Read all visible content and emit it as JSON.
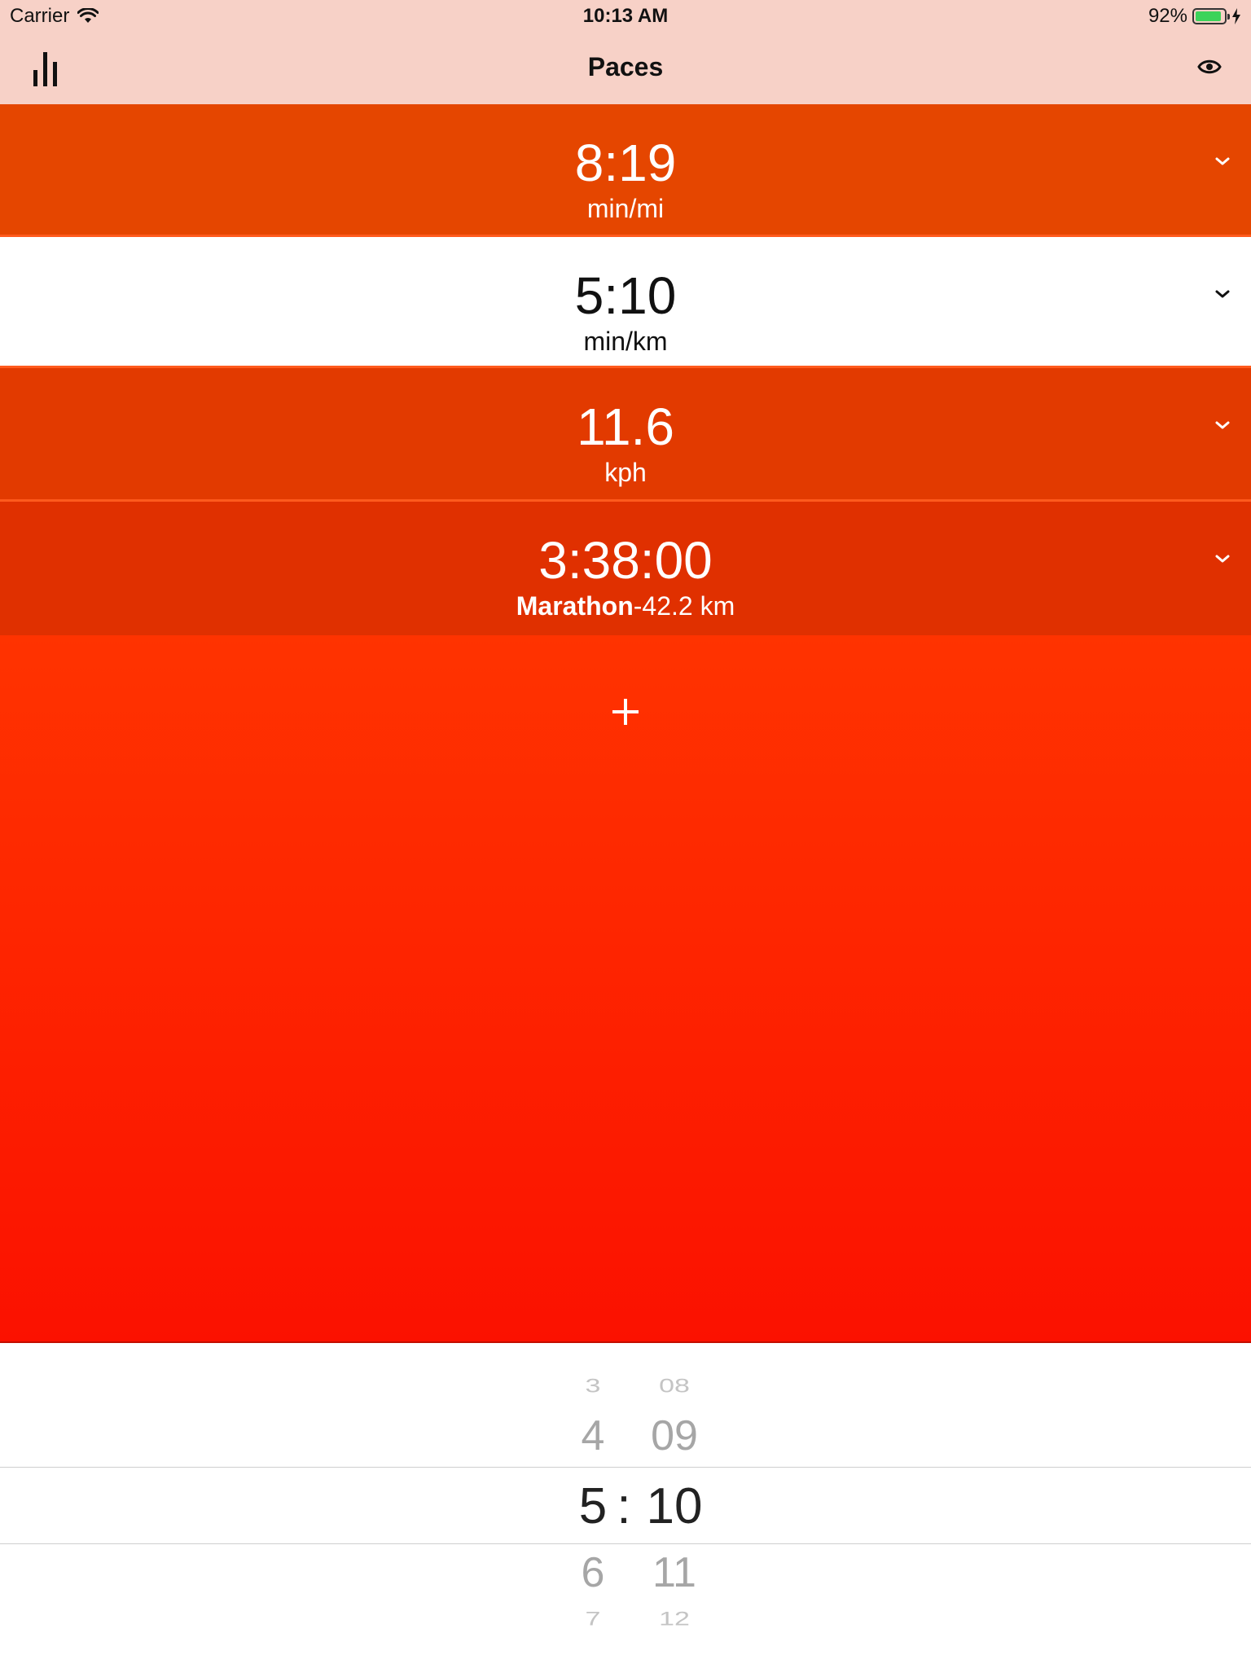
{
  "status_bar": {
    "carrier": "Carrier",
    "time": "10:13 AM",
    "battery": "92%",
    "battery_level": 0.92,
    "battery_color": "#3cd35a"
  },
  "nav": {
    "title": "Paces",
    "left_icon": "bar-chart-icon",
    "right_icon": "eye-icon"
  },
  "rows": [
    {
      "value": "8:19",
      "unit": "min/mi",
      "color": "#e54600"
    },
    {
      "value": "5:10",
      "unit": "min/km",
      "color": "#ffffff"
    },
    {
      "value": "11.6",
      "unit": "kph",
      "color": "#e23a00"
    },
    {
      "value": "3:38:00",
      "unit_bold": "Marathon",
      "unit": "-42.2 km",
      "color": "#e03000"
    }
  ],
  "add_button": {
    "icon": "plus-icon"
  },
  "picker": {
    "hours": [
      "3",
      "4",
      "5",
      "6",
      "7"
    ],
    "minutes": [
      "08",
      "09",
      "10",
      "11",
      "12"
    ],
    "separator": ":",
    "selected_hours": "5",
    "selected_minutes": "10"
  }
}
